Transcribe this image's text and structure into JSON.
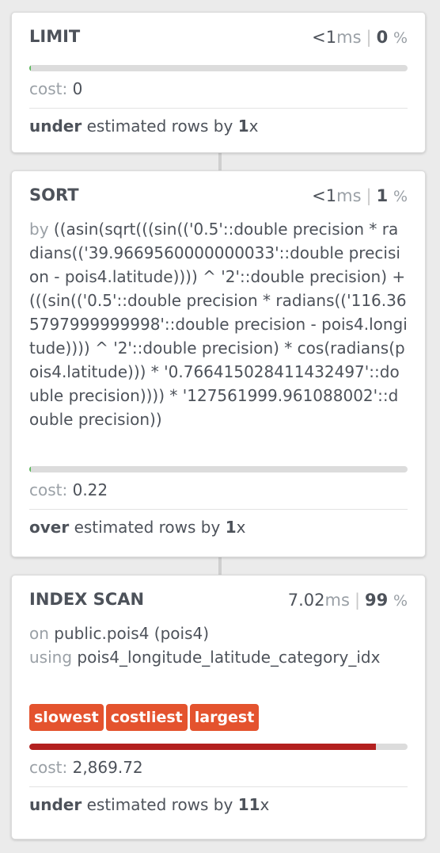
{
  "nodes": [
    {
      "title": "LIMIT",
      "duration_value": "<1",
      "duration_unit": "ms",
      "percent": "0",
      "percent_sign": "%",
      "cost_label": "cost:",
      "cost_value": "0",
      "bar_fraction": 0.004,
      "bar_color": "#5cb85c",
      "estimate_direction": "under",
      "estimate_text": "estimated rows by",
      "estimate_factor": "1",
      "estimate_suffix": "x"
    },
    {
      "title": "SORT",
      "duration_value": "<1",
      "duration_unit": "ms",
      "percent": "1",
      "percent_sign": "%",
      "detail_label": "by",
      "detail_value": "((asin(sqrt(((sin(('0.5'::double precision * radians(('39.9669560000000033'::double precision - pois4.latitude)))) ^ '2'::double precision) + (((sin(('0.5'::double precision * radians(('116.365797999999998'::double precision - pois4.longitude)))) ^ '2'::double precision) * cos(radians(pois4.latitude))) * '0.766415028411432497'::double precision)))) * '127561999.961088002'::double precision))",
      "cost_label": "cost:",
      "cost_value": "0.22",
      "bar_fraction": 0.004,
      "bar_color": "#5cb85c",
      "estimate_direction": "over",
      "estimate_text": "estimated rows by",
      "estimate_factor": "1",
      "estimate_suffix": "x"
    },
    {
      "title": "INDEX SCAN",
      "duration_value": "7.02",
      "duration_unit": "ms",
      "percent": "99",
      "percent_sign": "%",
      "on_label": "on",
      "on_value": "public.pois4 (pois4)",
      "using_label": "using",
      "using_value": "pois4_longitude_latitude_category_idx",
      "tags": [
        "slowest",
        "costliest",
        "largest"
      ],
      "tag_color": "#e4532e",
      "cost_label": "cost:",
      "cost_value": "2,869.72",
      "bar_fraction": 0.917,
      "bar_color": "#b3201f",
      "estimate_direction": "under",
      "estimate_text": "estimated rows by",
      "estimate_factor": "11",
      "estimate_suffix": "x"
    }
  ]
}
